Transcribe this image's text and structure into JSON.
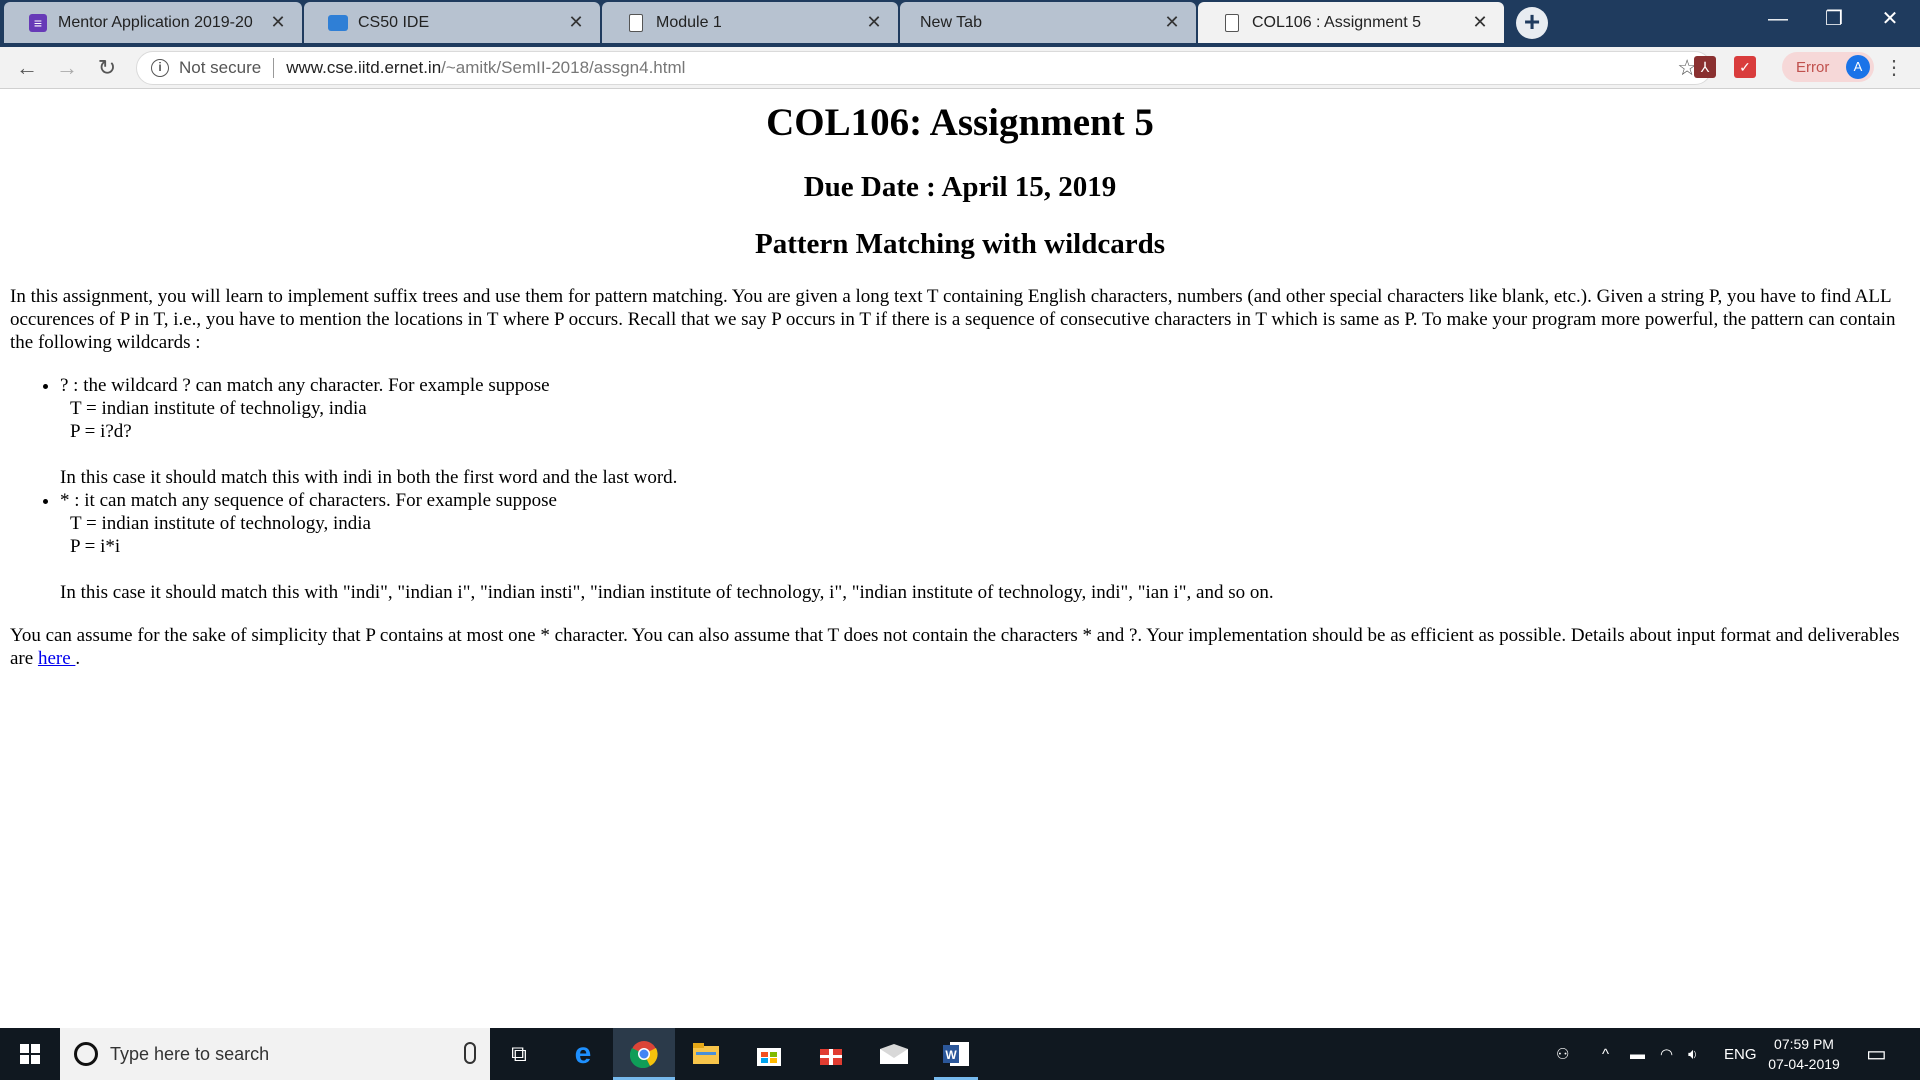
{
  "tabs": [
    {
      "title": "Mentor Application 2019-20",
      "favicon": "google-forms-icon"
    },
    {
      "title": "CS50 IDE",
      "favicon": "cs50-cloud-icon"
    },
    {
      "title": "Module 1",
      "favicon": "page-icon"
    },
    {
      "title": "New Tab",
      "favicon": "none"
    },
    {
      "title": "COL106 : Assignment 5",
      "favicon": "page-icon",
      "active": true
    }
  ],
  "tab_close_glyph": "✕",
  "toolbar": {
    "security_label": "Not secure",
    "url_host": "www.cse.iitd.ernet.in",
    "url_path": "/~amitk/SemII-2018/assgn4.html",
    "error_label": "Error",
    "avatar_letter": "A"
  },
  "page": {
    "title": "COL106: Assignment 5",
    "due_date": "Due Date : April 15, 2019",
    "subtitle": "Pattern Matching with wildcards",
    "intro": "In this assignment, you will learn to implement suffix trees and use them for pattern matching. You are given a long text T containing English characters, numbers (and other special characters like blank, etc.). Given a string P, you have to find ALL occurences of P in T, i.e., you have to mention the locations in T where P occurs. Recall that we say P occurs in T if there is a sequence of consecutive characters in T which is same as P. To make your program more powerful, the pattern can contain the following wildcards :",
    "wildcards": [
      {
        "desc": "? : the wildcard ? can match any character. For example suppose",
        "t_line": "T = indian institute of technoligy, india",
        "p_line": "P = i?d?",
        "explanation": "In this case it should match this with indi in both the first word and the last word."
      },
      {
        "desc": "* : it can match any sequence of characters. For example suppose",
        "t_line": "T = indian institute of technology, india",
        "p_line": "P = i*i",
        "explanation": "In this case it should match this with \"indi\", \"indian i\", \"indian insti\", \"indian institute of technology, i\", \"indian institute of technology, indi\", \"ian i\", and so on."
      }
    ],
    "outro": "You can assume for the sake of simplicity that P contains at most one * character. You can also assume that T does not contain the characters * and ?. Your implementation should be as efficient as possible. Details about input format and deliverables are",
    "link_text": "here ",
    "outro_end": "."
  },
  "taskbar": {
    "search_placeholder": "Type here to search",
    "language": "ENG",
    "time": "07:59 PM",
    "date": "07-04-2019",
    "pinned": [
      "task-view-icon",
      "edge-icon",
      "chrome-icon",
      "file-explorer-icon",
      "store-icon",
      "gift-app-icon",
      "mail-icon",
      "word-icon"
    ]
  },
  "colors": {
    "tabstrip_bg": "#1f3b5e",
    "inactive_tab": "#b7c2d0",
    "active_tab": "#f2f2f2",
    "link": "#0000ee",
    "taskbar_bg": "#101820"
  }
}
